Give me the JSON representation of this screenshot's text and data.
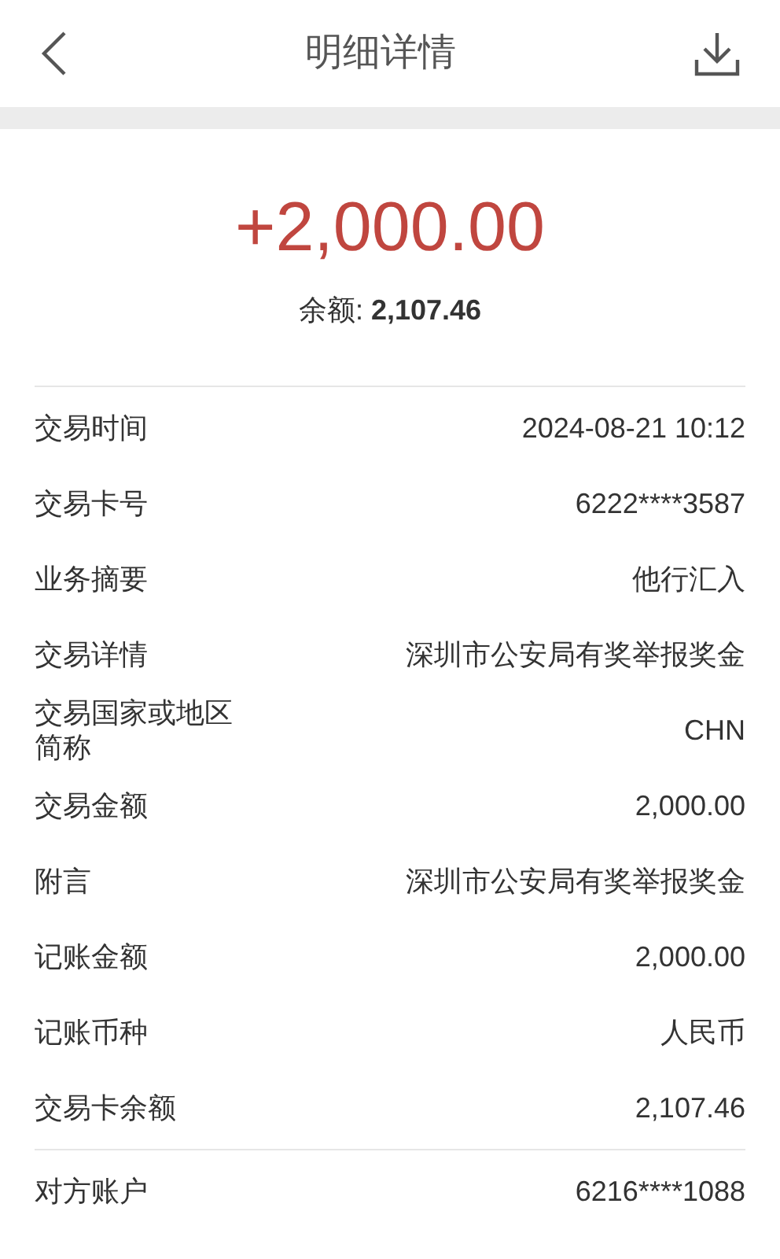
{
  "header": {
    "title": "明细详情"
  },
  "amount": "+2,000.00",
  "balance": {
    "label": "余额:",
    "value": "2,107.46"
  },
  "sections": [
    [
      {
        "label": "交易时间",
        "value": "2024-08-21 10:12"
      },
      {
        "label": "交易卡号",
        "value": "6222****3587"
      },
      {
        "label": "业务摘要",
        "value": "他行汇入"
      },
      {
        "label": "交易详情",
        "value": "深圳市公安局有奖举报奖金"
      },
      {
        "label": "交易国家或地区简称",
        "value": "CHN"
      },
      {
        "label": "交易金额",
        "value": "2,000.00"
      },
      {
        "label": "附言",
        "value": "深圳市公安局有奖举报奖金"
      },
      {
        "label": "记账金额",
        "value": "2,000.00"
      },
      {
        "label": "记账币种",
        "value": "人民币"
      },
      {
        "label": "交易卡余额",
        "value": "2,107.46"
      }
    ],
    [
      {
        "label": "对方账户",
        "value": "6216****1088"
      }
    ]
  ]
}
